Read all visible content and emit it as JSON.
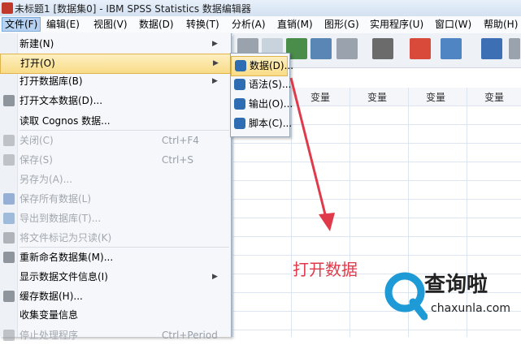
{
  "window": {
    "title": "未标题1 [数据集0] - IBM SPSS Statistics 数据编辑器"
  },
  "menubar": [
    "文件(F)",
    "编辑(E)",
    "视图(V)",
    "数据(D)",
    "转换(T)",
    "分析(A)",
    "直销(M)",
    "图形(G)",
    "实用程序(U)",
    "窗口(W)",
    "帮助(H)"
  ],
  "file_menu": [
    {
      "label": "新建(N)",
      "submenu": true
    },
    {
      "label": "打开(O)",
      "submenu": true,
      "highlight": true
    },
    {
      "label": "打开数据库(B)",
      "submenu": true
    },
    {
      "label": "打开文本数据(D)...",
      "icon": "text-data-icon"
    },
    {
      "label": "读取 Cognos 数据..."
    },
    {
      "label": "关闭(C)",
      "shortcut": "Ctrl+F4",
      "disabled": true,
      "icon": "close-doc-icon"
    },
    {
      "label": "保存(S)",
      "shortcut": "Ctrl+S",
      "disabled": true,
      "icon": "save-icon"
    },
    {
      "label": "另存为(A)...",
      "disabled": true
    },
    {
      "label": "保存所有数据(L)",
      "disabled": true,
      "icon": "save-all-icon"
    },
    {
      "label": "导出到数据库(T)...",
      "disabled": true,
      "icon": "export-db-icon"
    },
    {
      "label": "将文件标记为只读(K)",
      "disabled": true,
      "icon": "readonly-icon"
    },
    {
      "label": "重新命名数据集(M)...",
      "icon": "rename-dataset-icon"
    },
    {
      "label": "显示数据文件信息(I)",
      "submenu": true
    },
    {
      "label": "缓存数据(H)...",
      "icon": "cache-data-icon"
    },
    {
      "label": "收集变量信息"
    },
    {
      "label": "停止处理程序",
      "shortcut": "Ctrl+Period",
      "disabled": true,
      "icon": "stop-icon"
    }
  ],
  "open_submenu": [
    {
      "label": "数据(D)...",
      "highlight": true,
      "icon": "data-file-icon"
    },
    {
      "label": "语法(S)...",
      "icon": "syntax-file-icon"
    },
    {
      "label": "输出(O)...",
      "icon": "output-file-icon"
    },
    {
      "label": "脚本(C)...",
      "icon": "script-file-icon"
    }
  ],
  "grid": {
    "column_header": "变量"
  },
  "annotation": {
    "text": "打开数据",
    "color": "#e03a4a"
  },
  "watermark": {
    "brand": "查询啦",
    "url": "chaxunla.com"
  }
}
